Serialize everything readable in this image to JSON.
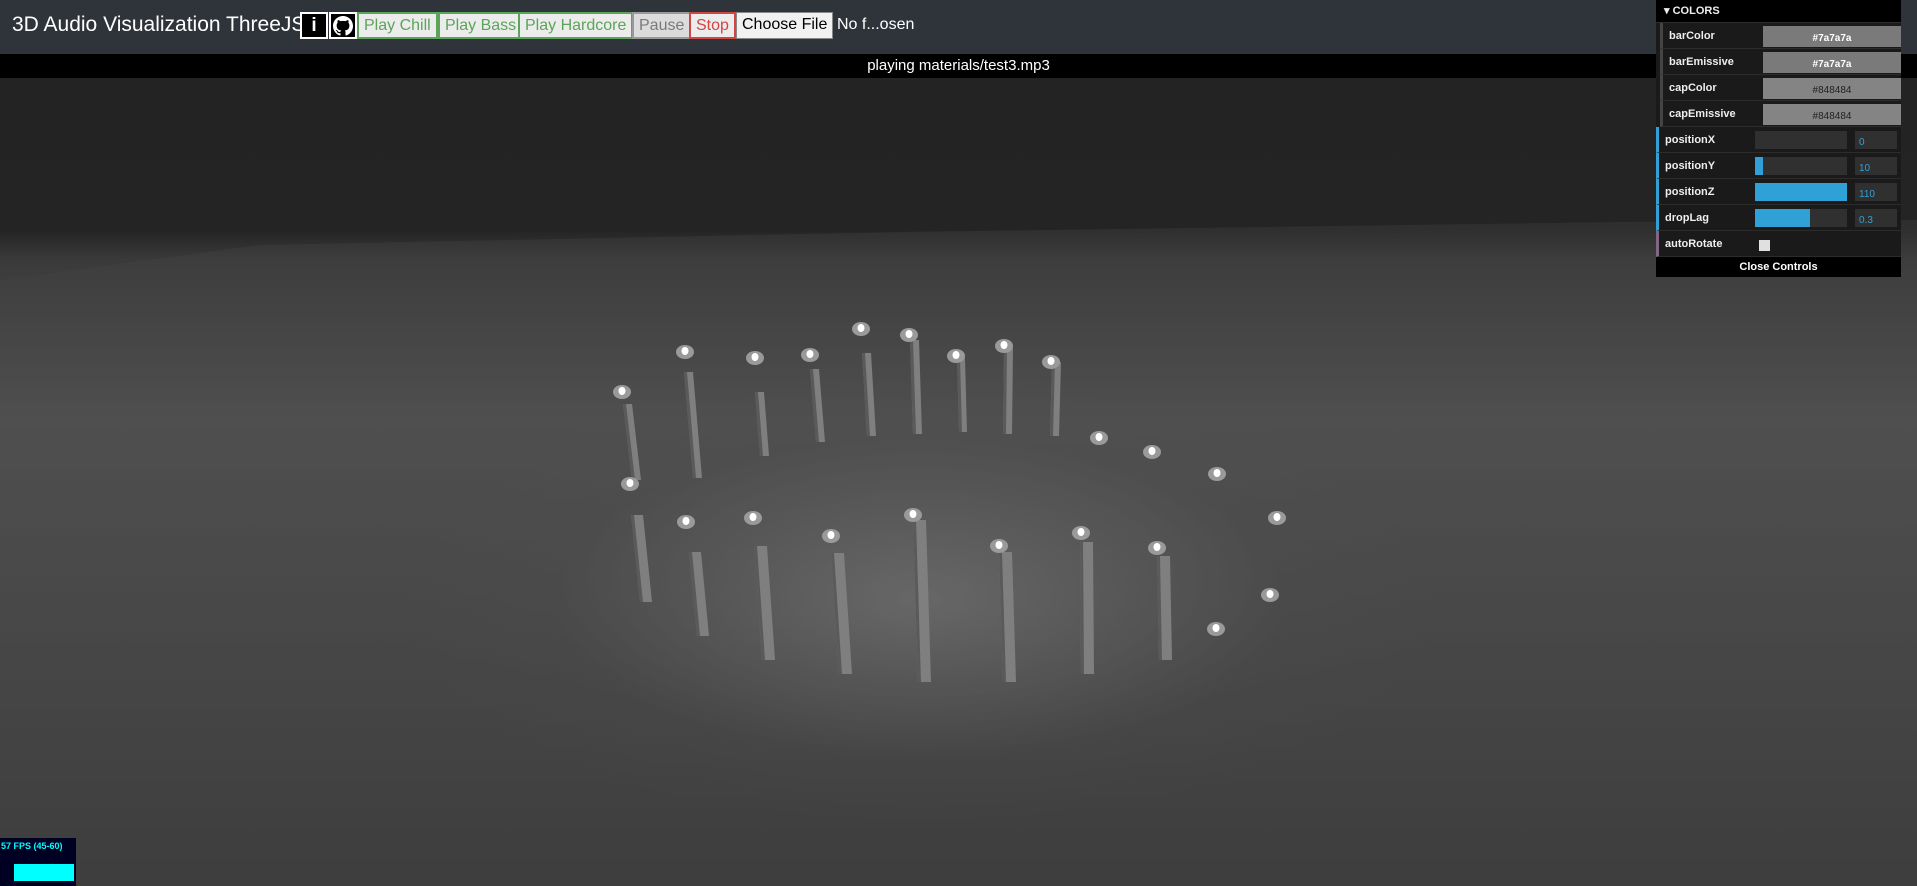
{
  "header": {
    "title": "3D Audio Visualization ThreeJS",
    "info_label": "i",
    "github_icon": "github-icon",
    "buttons": {
      "play_chill": "Play Chill",
      "play_bass": "Play Bass",
      "play_hardcore": "Play Hardcore",
      "pause": "Pause",
      "stop": "Stop",
      "choose_file": "Choose File"
    },
    "file_name": "No f...osen"
  },
  "status": {
    "text": "playing materials/test3.mp3"
  },
  "gui": {
    "folder_title": "COLORS",
    "colors": [
      {
        "label": "barColor",
        "value": "#7a7a7a"
      },
      {
        "label": "barEmissive",
        "value": "#7a7a7a"
      },
      {
        "label": "capColor",
        "value": "#848484"
      },
      {
        "label": "capEmissive",
        "value": "#848484"
      }
    ],
    "numbers": [
      {
        "label": "positionX",
        "value": "0",
        "fill": 0.0
      },
      {
        "label": "positionY",
        "value": "10",
        "fill": 0.09
      },
      {
        "label": "positionZ",
        "value": "110",
        "fill": 1.0
      },
      {
        "label": "dropLag",
        "value": "0.3",
        "fill": 0.6
      }
    ],
    "auto_rotate": {
      "label": "autoRotate",
      "checked": false
    },
    "close_label": "Close Controls"
  },
  "stats": {
    "fps": "57 FPS (45-60)"
  },
  "palette": {
    "bar_color": "#7a7a7a",
    "cap_color": "#848484",
    "slider_accent": "#2fa1d6",
    "chill_green": "#5aa55a",
    "stop_red": "#d24545"
  }
}
